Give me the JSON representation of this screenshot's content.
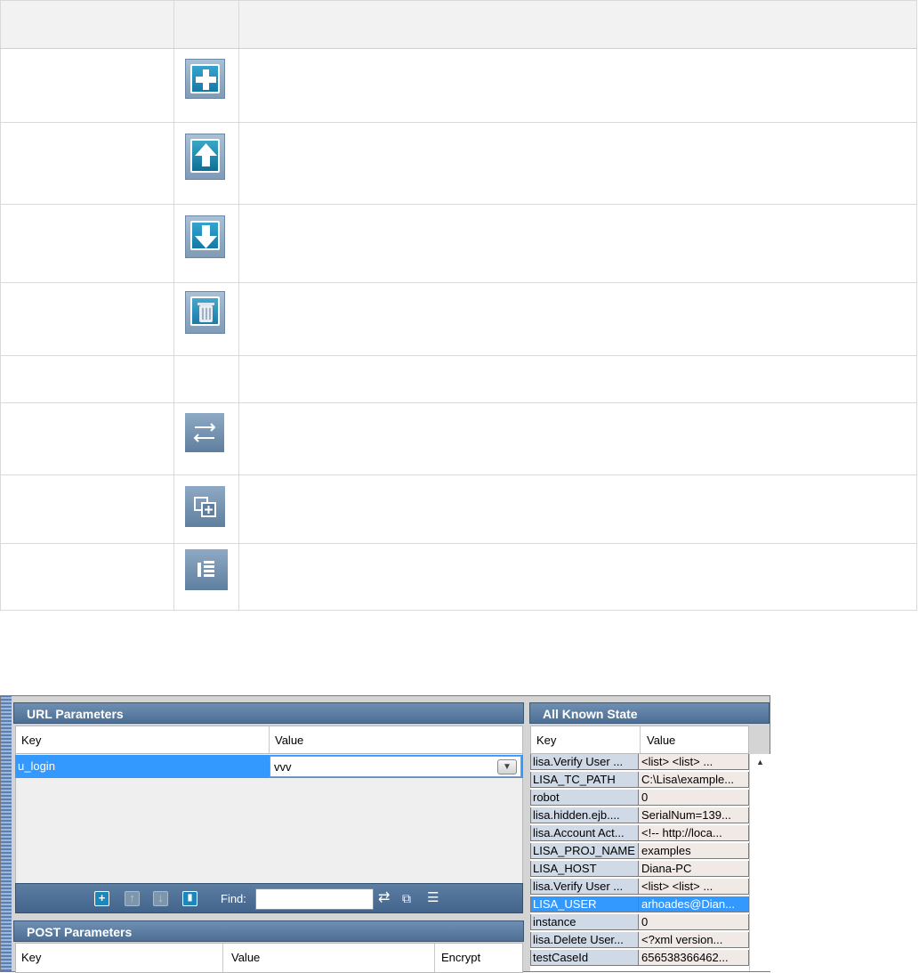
{
  "reference_table": {
    "rows": [
      {
        "icon": "add-icon"
      },
      {
        "icon": "move-up-icon"
      },
      {
        "icon": "move-down-icon"
      },
      {
        "icon": "delete-icon"
      },
      {
        "icon": ""
      },
      {
        "icon": "swap-icon"
      },
      {
        "icon": "copy-icon"
      },
      {
        "icon": "list-icon"
      }
    ]
  },
  "url_parameters": {
    "title": "URL Parameters",
    "columns": [
      "Key",
      "Value"
    ],
    "rows": [
      {
        "key": "u_login",
        "value": "vvv"
      }
    ],
    "toolbar": {
      "find_label": "Find:",
      "find_value": ""
    }
  },
  "post_parameters": {
    "title": "POST Parameters",
    "columns": [
      "Key",
      "Value",
      "Encrypt"
    ]
  },
  "all_known_state": {
    "title": "All Known State",
    "columns": [
      "Key",
      "Value"
    ],
    "rows": [
      {
        "key": "lisa.Verify User ...",
        "value": " <list>  <list>  ..."
      },
      {
        "key": "LISA_TC_PATH",
        "value": "C:\\Lisa\\example..."
      },
      {
        "key": "robot",
        "value": "0"
      },
      {
        "key": "lisa.hidden.ejb....",
        "value": " SerialNum=139..."
      },
      {
        "key": "lisa.Account Act...",
        "value": " <!-- http://loca..."
      },
      {
        "key": "LISA_PROJ_NAME",
        "value": "examples"
      },
      {
        "key": "LISA_HOST",
        "value": "Diana-PC"
      },
      {
        "key": "lisa.Verify User ...",
        "value": " <list>  <list>  ..."
      },
      {
        "key": "LISA_USER",
        "value": "arhoades@Dian..."
      },
      {
        "key": "instance",
        "value": "0"
      },
      {
        "key": "lisa.Delete User...",
        "value": " <?xml version..."
      },
      {
        "key": "testCaseId",
        "value": "656538366462..."
      }
    ],
    "selected_index": 8
  },
  "colors": {
    "selection": "#3399ff",
    "panel_header": "#4d6f94",
    "icon_blue": "#1479a6"
  }
}
